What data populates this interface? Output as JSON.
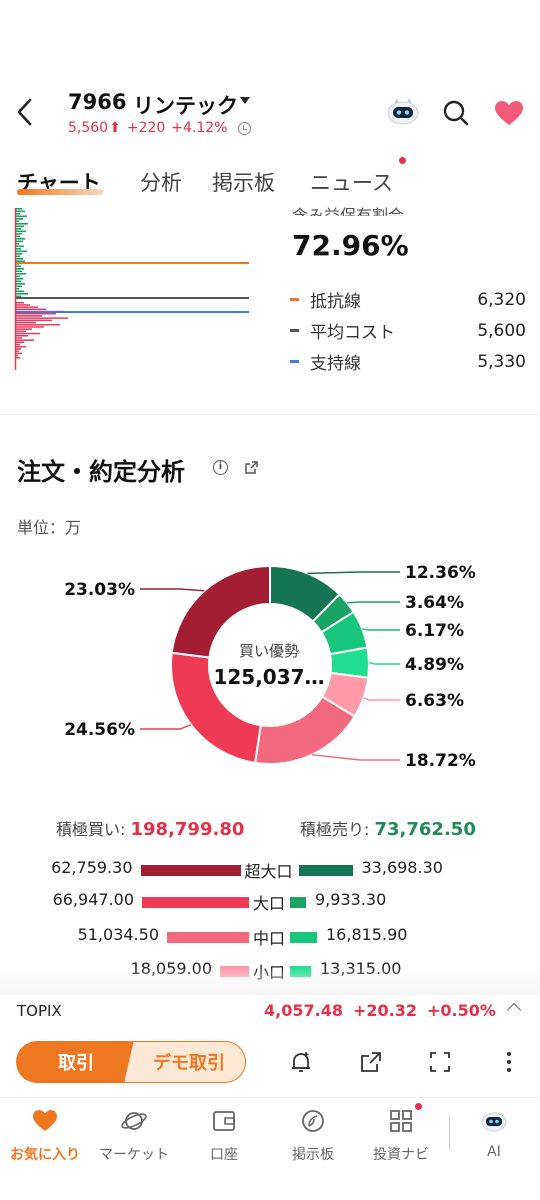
{
  "header": {
    "code": "7966",
    "name": "リンテック",
    "price": "5,560",
    "change": "+220",
    "change_pct": "+4.12%",
    "up_arrow": "⬆"
  },
  "tabs": [
    "チャート",
    "分析",
    "掲示板",
    "ニュース"
  ],
  "holding": {
    "cut_text": "含み益保有割合",
    "percent": "72.96%",
    "legend": [
      {
        "label": "抵抗線",
        "value": "6,320",
        "color": "#f07722"
      },
      {
        "label": "平均コスト",
        "value": "5,600",
        "color": "#555555"
      },
      {
        "label": "支持線",
        "value": "5,330",
        "color": "#3b7ddd"
      }
    ]
  },
  "order": {
    "title": "注文・約定分析",
    "unit": "単位：万",
    "center_label": "買い優勢",
    "center_value": "125,037…",
    "buy_total_label": "積極買い:",
    "buy_total": "198,799.80",
    "sell_total_label": "積極売り:",
    "sell_total": "73,762.50",
    "rows": [
      {
        "buy": "62,759.30",
        "cat": "超大口",
        "sell": "33,698.30"
      },
      {
        "buy": "66,947.00",
        "cat": "大口",
        "sell": "9,933.30"
      },
      {
        "buy": "51,034.50",
        "cat": "中口",
        "sell": "16,815.90"
      },
      {
        "buy": "18,059.00",
        "cat": "小口",
        "sell": "13,315.00"
      }
    ]
  },
  "chart_data": {
    "type": "pie",
    "categories": [
      "積極売り 超大口",
      "積極売り 大口",
      "積極売り 中口",
      "積極売り 小口",
      "積極買い 小口",
      "積極買い 中口",
      "積極買い 大口",
      "積極買い 超大口"
    ],
    "values": [
      12.36,
      3.64,
      6.17,
      4.89,
      6.63,
      18.72,
      24.56,
      23.03
    ],
    "labels": [
      "12.36%",
      "3.64%",
      "6.17%",
      "4.89%",
      "6.63%",
      "18.72%",
      "24.56%",
      "23.03%"
    ],
    "colors": [
      "#157451",
      "#1aa363",
      "#15c67c",
      "#22dd8e",
      "#ff9aa8",
      "#f36a7e",
      "#ef3a55",
      "#a31d33"
    ],
    "donut": true
  },
  "ticker": {
    "name": "TOPIX",
    "value": "4,057.48",
    "change": "+20.32",
    "change_pct": "+0.50%"
  },
  "actions": {
    "trade": "取引",
    "demo": "デモ取引"
  },
  "nav": [
    "お気に入り",
    "マーケット",
    "口座",
    "掲示板",
    "投資ナビ",
    "AI"
  ],
  "colors": {
    "accent": "#f07722",
    "up": "#e5304a",
    "down": "#1f8a5b"
  }
}
